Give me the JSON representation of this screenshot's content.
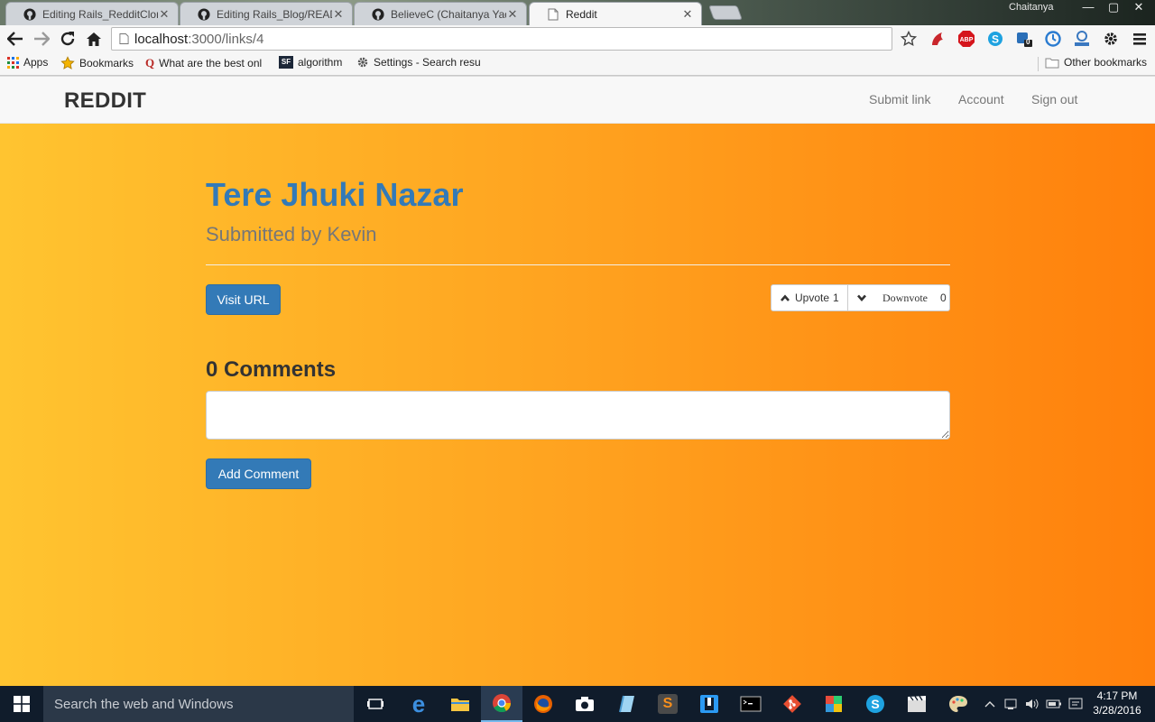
{
  "browser": {
    "tabs": [
      {
        "title": "Editing Rails_RedditClone/",
        "icon": "github-icon",
        "active": false
      },
      {
        "title": "Editing Rails_Blog/READM",
        "icon": "github-icon",
        "active": false
      },
      {
        "title": "BelieveC (Chaitanya Yadav",
        "icon": "github-icon",
        "active": false
      },
      {
        "title": "Reddit",
        "icon": "page-icon",
        "active": true
      }
    ],
    "user_name": "Chaitanya",
    "address": {
      "host": "localhost",
      "path": ":3000/links/4"
    },
    "bookmarks": [
      {
        "label": "Apps",
        "icon": "apps-grid-icon"
      },
      {
        "label": "Bookmarks",
        "icon": "star-icon"
      },
      {
        "label": "What are the best onl",
        "icon": "quora-icon"
      },
      {
        "label": "algorithm",
        "icon": "sf-icon"
      },
      {
        "label": "Settings - Search resu",
        "icon": "gear-icon"
      }
    ],
    "other_bookmarks": "Other bookmarks",
    "extension_badge": "0"
  },
  "site": {
    "brand": "REDDIT",
    "nav": {
      "submit": "Submit link",
      "account": "Account",
      "signout": "Sign out"
    }
  },
  "link": {
    "title": "Tere Jhuki Nazar",
    "submitted": "Submitted by Kevin",
    "visit_label": "Visit URL",
    "upvote_label": "Upvote",
    "upvote_count": "1",
    "downvote_label": "Downvote",
    "downvote_count": "0"
  },
  "comments": {
    "heading": "0 Comments",
    "textarea_value": "",
    "add_label": "Add Comment"
  },
  "taskbar": {
    "search_placeholder": "Search the web and Windows",
    "time": "4:17 PM",
    "date": "3/28/2016"
  },
  "colors": {
    "accent_blue": "#337ab7",
    "gradient_start": "#ffc430",
    "gradient_end": "#ff800c"
  }
}
